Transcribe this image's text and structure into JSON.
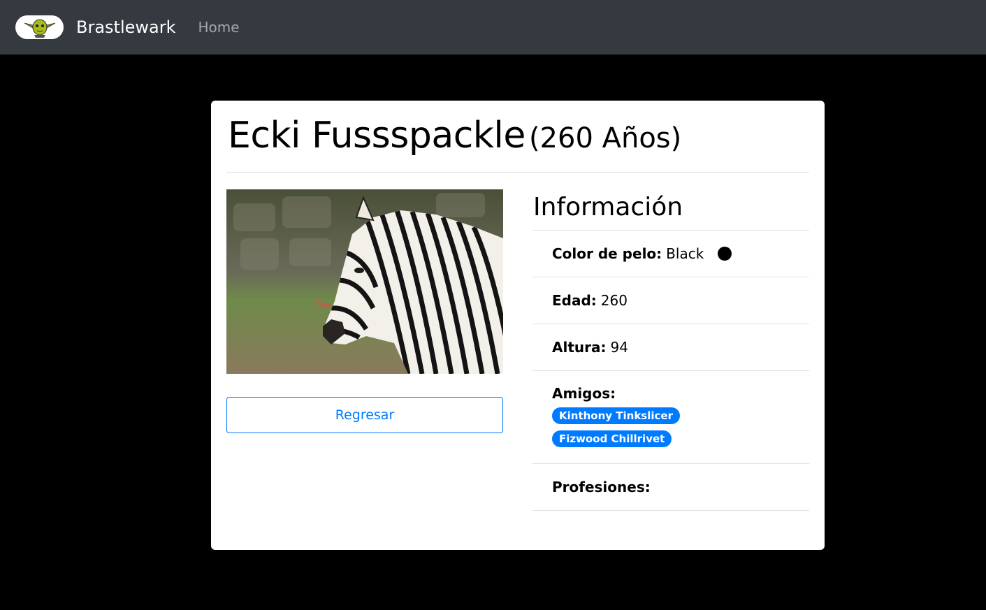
{
  "navbar": {
    "brand": "Brastlewark",
    "home_link": "Home",
    "logo_icon": "yoda-logo-icon"
  },
  "profile": {
    "name": "Ecki Fussspackle",
    "age_label": "(260 Años)",
    "photo": "zebra-photo",
    "back_button": "Regresar"
  },
  "info": {
    "heading": "Información",
    "hair_color_label": "Color de pelo:",
    "hair_color_value": "Black",
    "hair_color_swatch": "#000000",
    "age_label": "Edad:",
    "age_value": "260",
    "height_label": "Altura:",
    "height_value": "94",
    "friends_label": "Amigos:",
    "friends": [
      "Kinthony Tinkslicer",
      "Fizwood Chillrivet"
    ],
    "professions_label": "Profesiones:"
  },
  "colors": {
    "navbar_bg": "#343a40",
    "accent": "#007bff",
    "page_bg": "#000000"
  }
}
